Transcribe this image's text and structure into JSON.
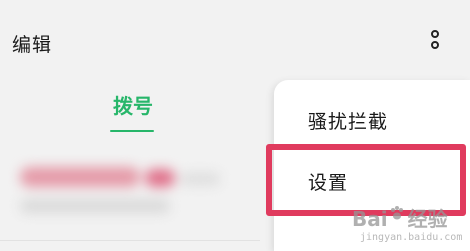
{
  "header": {
    "edit_label": "编辑",
    "more_icon": "more-vertical-icon"
  },
  "tabs": [
    {
      "label": "拨号",
      "active": true
    }
  ],
  "menu": {
    "items": [
      {
        "label": "骚扰拦截"
      },
      {
        "label": "设置",
        "highlighted": true
      }
    ]
  },
  "watermark": {
    "logo_text": "Bai",
    "logo_text_2": "经验",
    "sub_text": "jingyan.baidu.com"
  },
  "colors": {
    "accent": "#27b66a",
    "highlight": "#e03b5e",
    "background": "#f2f2f2",
    "menu_background": "#ffffff"
  }
}
